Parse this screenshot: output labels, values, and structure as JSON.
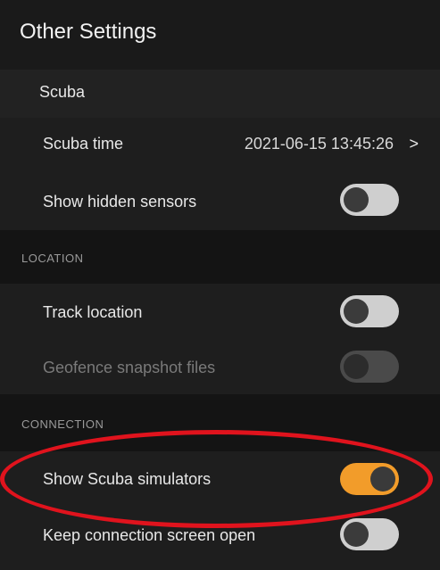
{
  "header": {
    "title": "Other Settings"
  },
  "scuba_section": {
    "title": "Scuba",
    "scuba_time": {
      "label": "Scuba time",
      "value": "2021-06-15 13:45:26",
      "chevron": ">"
    },
    "show_hidden_sensors": {
      "label": "Show hidden sensors",
      "enabled": false
    }
  },
  "location_section": {
    "title": "LOCATION",
    "track_location": {
      "label": "Track location",
      "enabled": false
    },
    "geofence_snapshot_files": {
      "label": "Geofence snapshot files",
      "enabled": false,
      "disabled": true
    }
  },
  "connection_section": {
    "title": "CONNECTION",
    "show_scuba_simulators": {
      "label": "Show Scuba simulators",
      "enabled": true
    },
    "keep_connection_screen_open": {
      "label": "Keep connection screen open",
      "enabled": false
    }
  },
  "colors": {
    "toggle_on": "#f29c2a",
    "toggle_off": "#cfcfcf",
    "highlight": "#e0131d"
  }
}
